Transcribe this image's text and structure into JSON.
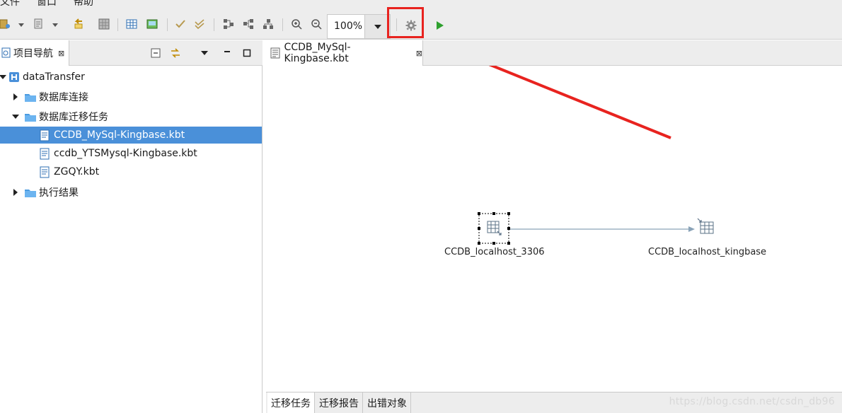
{
  "menubar": {
    "items": [
      "文件",
      "窗口",
      "帮助"
    ]
  },
  "toolbar": {
    "zoom_value": "100%"
  },
  "colors": {
    "accent": "#4a90d9",
    "highlight": "#e8231f",
    "run": "#2ea02e"
  },
  "navigator": {
    "title": "项目导航",
    "tree": [
      {
        "label": "dataTransfer",
        "icon": "project-icon"
      },
      {
        "label": "数据库连接",
        "icon": "folder-icon"
      },
      {
        "label": "数据库迁移任务",
        "icon": "folder-icon"
      },
      {
        "label": "CCDB_MySql-Kingbase.kbt",
        "icon": "file-icon",
        "selected": true
      },
      {
        "label": "ccdb_YTSMysql-Kingbase.kbt",
        "icon": "file-icon"
      },
      {
        "label": "ZGQY.kbt",
        "icon": "file-icon"
      },
      {
        "label": "执行结果",
        "icon": "folder-icon"
      }
    ]
  },
  "editor": {
    "tab_label": "CCDB_MySql-Kingbase.kbt",
    "source_node": "CCDB_localhost_3306",
    "target_node": "CCDB_localhost_kingbase"
  },
  "bottom_tabs": [
    "迁移任务",
    "迁移报告",
    "出错对象"
  ],
  "watermark": "https://blog.csdn.net/csdn_db96"
}
